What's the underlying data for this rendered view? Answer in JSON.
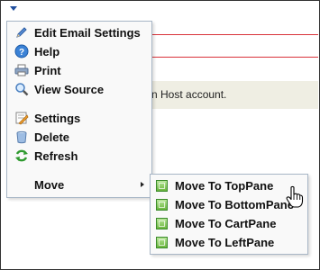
{
  "menu": {
    "items": [
      {
        "label": "Edit Email Settings",
        "icon": "pencil-icon"
      },
      {
        "label": "Help",
        "icon": "help-icon"
      },
      {
        "label": "Print",
        "icon": "print-icon"
      },
      {
        "label": "View Source",
        "icon": "magnifier-icon"
      },
      {
        "label": "Settings",
        "icon": "settings-icon"
      },
      {
        "label": "Delete",
        "icon": "trash-icon"
      },
      {
        "label": "Refresh",
        "icon": "refresh-icon"
      },
      {
        "label": "Move",
        "icon": ""
      }
    ]
  },
  "submenu": {
    "items": [
      {
        "label": "Move To TopPane"
      },
      {
        "label": "Move To BottomPane"
      },
      {
        "label": "Move To CartPane"
      },
      {
        "label": "Move To LeftPane"
      }
    ]
  },
  "notice": {
    "text": "n Host account."
  },
  "colors": {
    "accent": "#1f4e9e",
    "rule": "#d9333a",
    "notice_bg": "#efeee3",
    "pane_icon": "#69b53c"
  }
}
